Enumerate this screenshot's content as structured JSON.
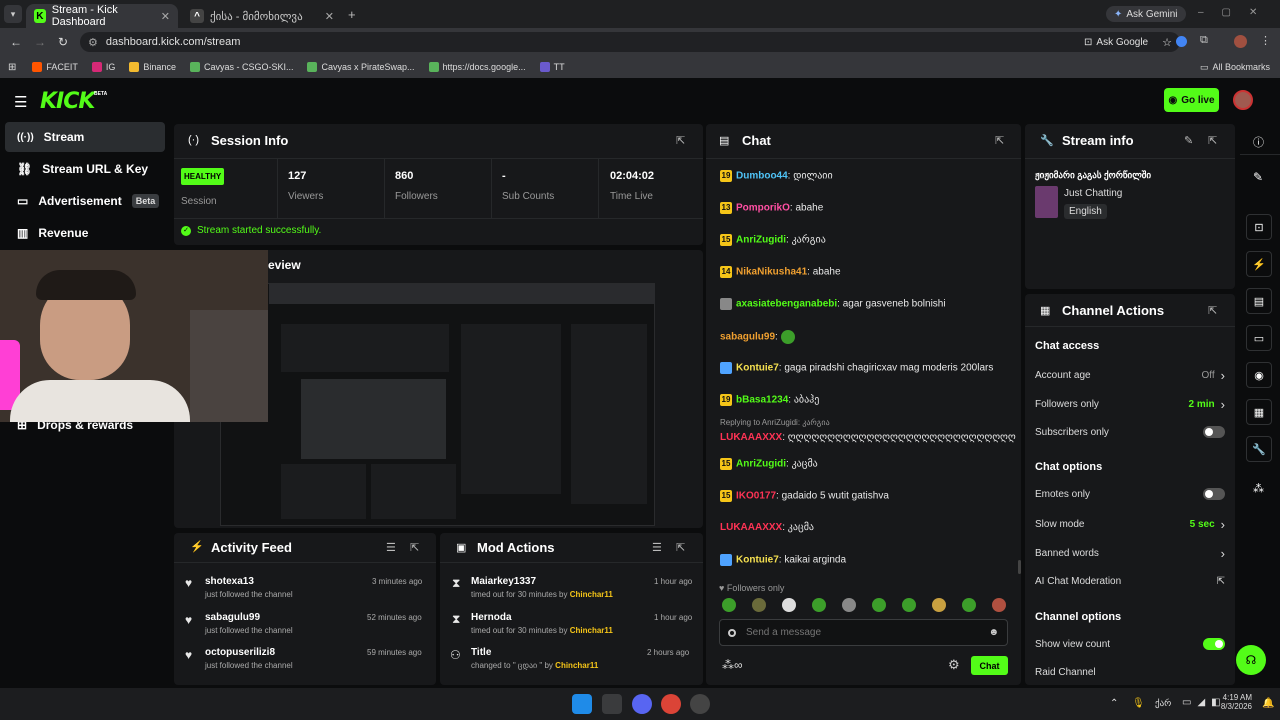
{
  "browser": {
    "tabs": [
      {
        "title": "Stream - Kick Dashboard"
      },
      {
        "title": "ქისა - მიმოხილვა"
      }
    ],
    "ask_gemini": "Ask Gemini",
    "url": "dashboard.kick.com/stream",
    "ask_google": "Ask Google",
    "bookmarks": [
      "FACEIT",
      "IG",
      "Binance",
      "Cavyas - CSGO-SKI...",
      "Cavyas x PirateSwap...",
      "https://docs.google...",
      "TT"
    ],
    "all_bookmarks": "All Bookmarks"
  },
  "header": {
    "logo": "KICK",
    "beta": "BETA",
    "go_live": "Go live"
  },
  "sidebar": {
    "items": [
      {
        "label": "Stream"
      },
      {
        "label": "Stream URL & Key"
      },
      {
        "label": "Advertisement",
        "badge": "Beta"
      },
      {
        "label": "Revenue"
      },
      {
        "label": "Drops & rewards"
      }
    ]
  },
  "session": {
    "title": "Session Info",
    "status": "HEALTHY",
    "status_label": "Session",
    "stats": [
      {
        "value": "127",
        "label": "Viewers"
      },
      {
        "value": "860",
        "label": "Followers"
      },
      {
        "value": "-",
        "label": "Sub Counts"
      },
      {
        "value": "02:04:02",
        "label": "Time Live"
      }
    ],
    "message": "Stream started successfully."
  },
  "preview": {
    "title": "eview"
  },
  "chat": {
    "title": "Chat",
    "messages": [
      {
        "badge": "19",
        "badge_color": "#f5c518",
        "user": "Dumboo44",
        "user_color": "#4fc3f7",
        "text": "დილაიი"
      },
      {
        "badge": "13",
        "badge_color": "#f5c518",
        "user": "PomporikO",
        "user_color": "#ff4fa3",
        "text": "abahe"
      },
      {
        "badge": "15",
        "badge_color": "#f5c518",
        "user": "AnriZugidi",
        "user_color": "#53fc18",
        "text": "კარგია"
      },
      {
        "badge": "14",
        "badge_color": "#f5c518",
        "user": "NikaNikusha41",
        "user_color": "#f0a030",
        "text": "abahe"
      },
      {
        "badge": "",
        "badge_color": "#888888",
        "user": "axasiatebenganabebi",
        "user_color": "#53fc18",
        "text": "agar gasveneb bolnishi"
      },
      {
        "badge": "",
        "badge_color": "",
        "user": "sabagulu99",
        "user_color": "#f0a030",
        "text": ""
      },
      {
        "badge": "",
        "badge_color": "#4fa3ff",
        "user": "Kontuie7",
        "user_color": "#f5e050",
        "text": "gaga piradshi chagiricxav mag moderis 200lars"
      },
      {
        "badge": "19",
        "badge_color": "#f5c518",
        "user": "bBasa1234",
        "user_color": "#53fc18",
        "text": "აბაჰე"
      },
      {
        "reply": "Replying to AnriZugidi: კარგია",
        "badge": "",
        "badge_color": "",
        "user": "LUKAAAXXX",
        "user_color": "#ff3355",
        "text": "ღღღღღღღღღღღღღღღღღღღღღღღღღღღღღ"
      },
      {
        "badge": "15",
        "badge_color": "#f5c518",
        "user": "AnriZugidi",
        "user_color": "#53fc18",
        "text": "კაცმა"
      },
      {
        "badge": "15",
        "badge_color": "#f5c518",
        "user": "IKO0177",
        "user_color": "#ff3355",
        "text": "gadaido 5 wutit gatishva"
      },
      {
        "badge": "",
        "badge_color": "",
        "user": "LUKAAAXXX",
        "user_color": "#ff3355",
        "text": "კაცმა"
      },
      {
        "badge": "",
        "badge_color": "#4fa3ff",
        "user": "Kontuie7",
        "user_color": "#f5e050",
        "text": "kaikai arginda"
      }
    ],
    "followers_only": "Followers only",
    "placeholder": "Send a message",
    "send": "Chat"
  },
  "stream_info": {
    "title": "Stream info",
    "stream_title": "ჟიჟიმარი გაგას ქორწილში",
    "category": "Just Chatting",
    "language": "English"
  },
  "channel_actions": {
    "title": "Channel Actions",
    "sections": [
      {
        "heading": "Chat access",
        "rows": [
          {
            "label": "Account age",
            "value": "Off",
            "kind": "arrow"
          },
          {
            "label": "Followers only",
            "value": "2 min",
            "kind": "arrow",
            "green": true
          },
          {
            "label": "Subscribers only",
            "value": "",
            "kind": "toggle",
            "on": false
          }
        ]
      },
      {
        "heading": "Chat options",
        "rows": [
          {
            "label": "Emotes only",
            "value": "",
            "kind": "toggle",
            "on": false
          },
          {
            "label": "Slow mode",
            "value": "5 sec",
            "kind": "arrow",
            "green": true
          },
          {
            "label": "Banned words",
            "value": "",
            "kind": "arrow"
          },
          {
            "label": "AI Chat Moderation",
            "value": "",
            "kind": "ext"
          }
        ]
      },
      {
        "heading": "Channel options",
        "rows": [
          {
            "label": "Show view count",
            "value": "",
            "kind": "toggle",
            "on": true
          },
          {
            "label": "Raid Channel",
            "value": "",
            "kind": "none"
          }
        ]
      }
    ]
  },
  "activity": {
    "title": "Activity Feed",
    "items": [
      {
        "name": "shotexa13",
        "sub": "just followed the channel",
        "time": "3 minutes ago"
      },
      {
        "name": "sabagulu99",
        "sub": "just followed the channel",
        "time": "52 minutes ago"
      },
      {
        "name": "octopuserilizi8",
        "sub": "just followed the channel",
        "time": "59 minutes ago"
      }
    ]
  },
  "mod_actions": {
    "title": "Mod Actions",
    "items": [
      {
        "name": "Maiarkey1337",
        "sub": "timed out for 30 minutes by",
        "by": "Chinchar11",
        "time": "1 hour ago"
      },
      {
        "name": "Hernoda",
        "sub": "timed out for 30 minutes by",
        "by": "Chinchar11",
        "time": "1 hour ago"
      },
      {
        "name": "Title",
        "sub": "changed to \" ცდაი \" by",
        "by": "Chinchar11",
        "time": "2 hours ago"
      }
    ]
  },
  "taskbar": {
    "lang": "ქარ",
    "time": "4:19 AM",
    "date": "8/3/2026"
  },
  "colors": {
    "accent": "#53fc18",
    "panel": "#17181a",
    "bg": "#0b0c0d"
  }
}
